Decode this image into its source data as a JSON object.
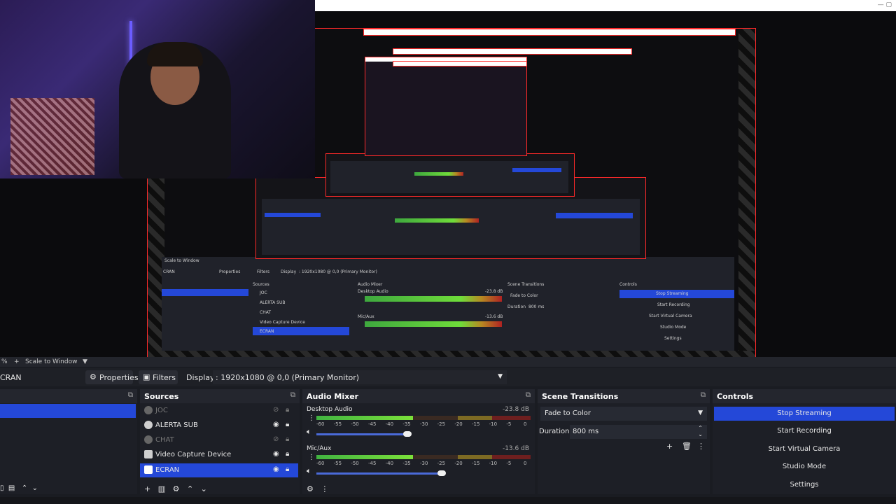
{
  "preview": {
    "title_buttons": "—  ▢"
  },
  "toolbar": {
    "zoom_label": "%",
    "plus": "+",
    "scale_label": "Scale to Window",
    "caret": "▼"
  },
  "propbar": {
    "scene_name": "CRAN",
    "properties_label": "Properties",
    "filters_label": "Filters",
    "display_label": "Display",
    "display_value": ": 1920x1080 @ 0,0 (Primary Monitor)"
  },
  "sources": {
    "title": "Sources",
    "items": [
      {
        "label": "JOC",
        "visible": false
      },
      {
        "label": "ALERTA SUB",
        "visible": true
      },
      {
        "label": "CHAT",
        "visible": false
      },
      {
        "label": "Video Capture Device",
        "visible": true
      },
      {
        "label": "ECRAN",
        "visible": true,
        "selected": true
      }
    ]
  },
  "mixer": {
    "title": "Audio Mixer",
    "ticks": [
      "-60",
      "-55",
      "-50",
      "-45",
      "-40",
      "-35",
      "-30",
      "-25",
      "-20",
      "-15",
      "-10",
      "-5",
      "0"
    ],
    "channels": [
      {
        "name": "Desktop Audio",
        "db": "-23.8 dB",
        "level": 0.45,
        "fader": 0.62
      },
      {
        "name": "Mic/Aux",
        "db": "-13.6 dB",
        "level": 0.45,
        "fader": 0.85
      }
    ]
  },
  "transitions": {
    "title": "Scene Transitions",
    "selected": "Fade to Color",
    "duration_label": "Duration",
    "duration_value": "800 ms"
  },
  "controls": {
    "title": "Controls",
    "buttons": [
      "Stop Streaming",
      "Start Recording",
      "Start Virtual Camera",
      "Studio Mode",
      "Settings"
    ]
  },
  "nested_preview": {
    "scene": "CRAN",
    "properties": "Properties",
    "filters": "Filters",
    "display": "Display",
    "display_value": ": 1920x1080 @ 0,0 (Primary Monitor)",
    "sources_title": "Sources",
    "mixer_title": "Audio Mixer",
    "transitions_title": "Scene Transitions",
    "controls_title": "Controls",
    "src_items": [
      "JOC",
      "ALERTA SUB",
      "CHAT",
      "Video Capture Device",
      "ECRAN"
    ],
    "ch1": "Desktop Audio",
    "ch1_db": "-23.8 dB",
    "ch2": "Mic/Aux",
    "ch2_db": "-13.6 dB",
    "fade": "Fade to Color",
    "duration": "Duration",
    "duration_value": "800 ms",
    "buttons": [
      "Stop Streaming",
      "Start Recording",
      "Start Virtual Camera",
      "Studio Mode",
      "Settings"
    ],
    "scale": "Scale to Window"
  },
  "colors": {
    "accent": "#2448d8",
    "meter_green": "#41b341",
    "capture_border": "#ff2a2a"
  }
}
